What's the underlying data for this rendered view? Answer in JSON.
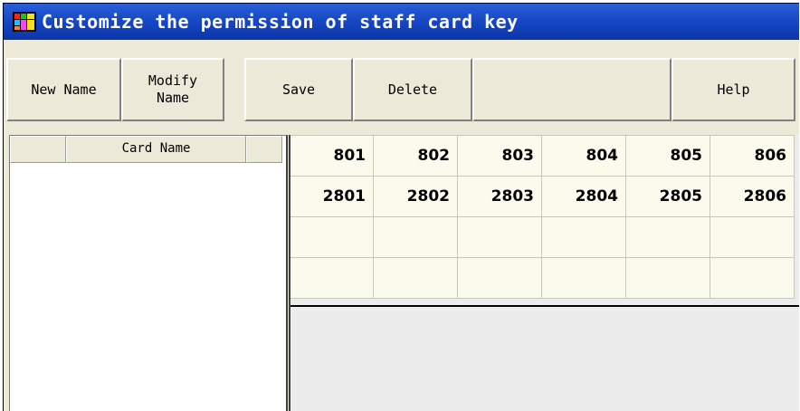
{
  "window": {
    "title": "Customize the permission of staff card key",
    "icon": "app-grid-icon"
  },
  "toolbar": {
    "new_name": "New Name",
    "modify_name": "Modify\nName",
    "save": "Save",
    "delete": "Delete",
    "help": "Help"
  },
  "card_list": {
    "header": "Card Name",
    "items": []
  },
  "grid": {
    "rows": [
      [
        "801",
        "802",
        "803",
        "804",
        "805",
        "806"
      ],
      [
        "2801",
        "2802",
        "2803",
        "2804",
        "2805",
        "2806"
      ],
      [
        "",
        "",
        "",
        "",
        "",
        ""
      ],
      [
        "",
        "",
        "",
        "",
        "",
        ""
      ]
    ]
  },
  "colors": {
    "titlebar": "#1646c4",
    "cell_bg": "#fbfbed",
    "panel_bg": "#ece9d8"
  }
}
